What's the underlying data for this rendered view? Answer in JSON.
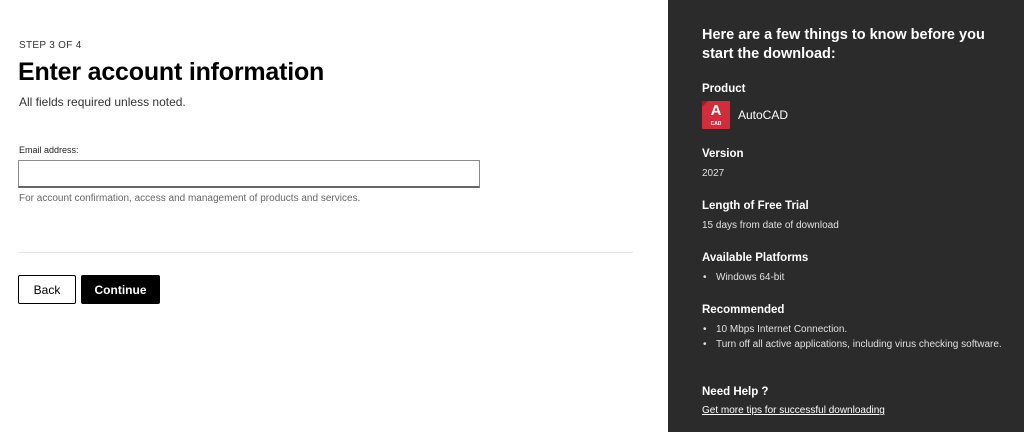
{
  "form": {
    "step_label": "STEP 3 OF 4",
    "title": "Enter account information",
    "subtitle": "All fields required unless noted.",
    "email": {
      "label": "Email address:",
      "value": "",
      "placeholder": "",
      "help": "For account confirmation, access and management of products and services."
    },
    "back_label": "Back",
    "continue_label": "Continue"
  },
  "info": {
    "heading": "Here are a few things to know before you start the download:",
    "product": {
      "label": "Product",
      "icon_letter": "A",
      "icon_sub": "CAD",
      "icon": "autocad-logo-icon",
      "name": "AutoCAD",
      "icon_color": "#d32c3a"
    },
    "version": {
      "label": "Version",
      "value": "2027"
    },
    "trial": {
      "label": "Length of Free Trial",
      "value": "15 days from date of download"
    },
    "platforms": {
      "label": "Available Platforms",
      "items": [
        "Windows 64-bit"
      ]
    },
    "recommended": {
      "label": "Recommended",
      "items": [
        "10 Mbps Internet Connection.",
        "Turn off all active applications, including virus checking software."
      ]
    },
    "help": {
      "label": "Need Help ?",
      "link": "Get more tips for successful downloading"
    }
  },
  "colors": {
    "panel_bg": "#2b2b2b",
    "primary_button": "#000000"
  }
}
